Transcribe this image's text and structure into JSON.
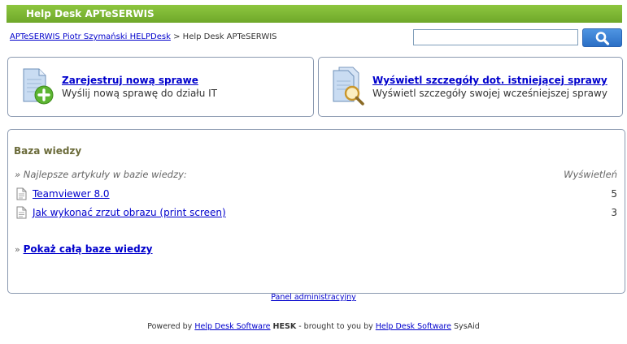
{
  "header": {
    "title": "Help Desk APTeSERWIS"
  },
  "breadcrumb": {
    "home_link": "APTeSERWIS Piotr Szymański HELPDesk",
    "separator": ">",
    "current": "Help Desk APTeSERWIS"
  },
  "search": {
    "value": "",
    "placeholder": "",
    "button_icon": "magnifier-icon"
  },
  "tiles": {
    "new_ticket": {
      "title": "Zarejestruj nową sprawe",
      "description": "Wyślij nową sprawę do działu IT",
      "icon": "document-add-icon"
    },
    "view_ticket": {
      "title": "Wyświetl szczegóły dot. istniejącej sprawy",
      "description": "Wyświetl szczegóły swojej wcześniejszej sprawy",
      "icon": "document-search-icon"
    }
  },
  "kb": {
    "title": "Baza wiedzy",
    "top_articles_label": "» Najlepsze artykuły w bazie wiedzy:",
    "views_header": "Wyświetleń",
    "articles": [
      {
        "title": "Teamviewer 8.0",
        "views": "5"
      },
      {
        "title": "Jak wykonać zrzut obrazu (print screen)",
        "views": "3"
      }
    ],
    "show_all_prefix": "»",
    "show_all_label": "Pokaż całą baze wiedzy"
  },
  "admin_link": "Panel administracyjny",
  "footer": {
    "powered_by": "Powered by",
    "link1": "Help Desk Software",
    "brand": "HESK",
    "brought": "- brought to you by",
    "link2": "Help Desk Software",
    "suffix": "SysAid"
  },
  "colors": {
    "header_green": "#7cb833",
    "link_blue": "#0000cc",
    "box_border": "#8a99b0",
    "kb_title": "#6b6b3a",
    "search_button": "#3a80d6"
  }
}
